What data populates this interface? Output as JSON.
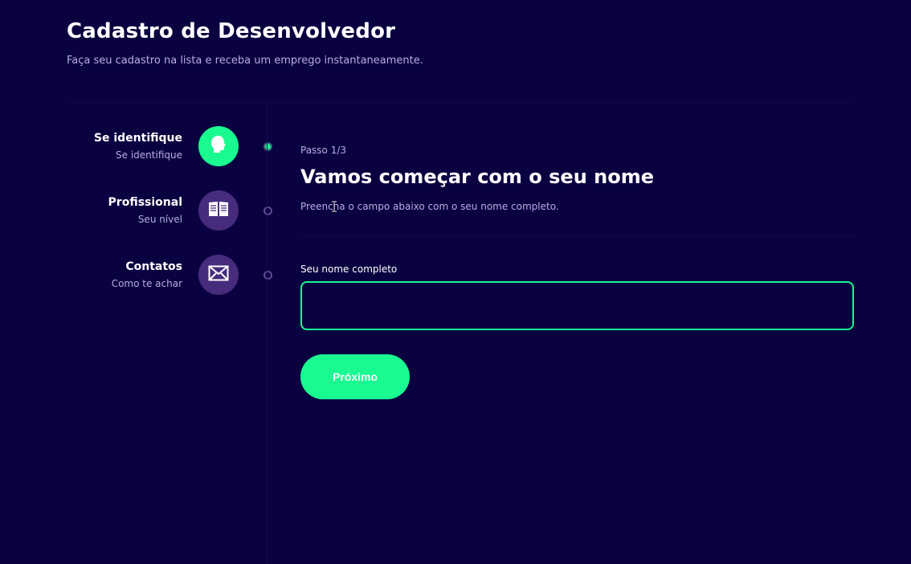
{
  "header": {
    "title": "Cadastro de Desenvolvedor",
    "subtitle": "Faça seu cadastro na lista e receba um emprego instantaneamente."
  },
  "steps": [
    {
      "title": "Se identifique",
      "subtitle": "Se identifique",
      "icon": "person-head-icon",
      "active": true
    },
    {
      "title": "Profissional",
      "subtitle": "Seu nível",
      "icon": "book-icon",
      "active": false
    },
    {
      "title": "Contatos",
      "subtitle": "Como te achar",
      "icon": "mail-icon",
      "active": false
    }
  ],
  "content": {
    "step_count": "Passo 1/3",
    "title": "Vamos começar com o seu nome",
    "lead": "Preencha o campo abaixo com o seu nome completo.",
    "field_label": "Seu nome completo",
    "field_value": "",
    "next_label": "Próximo"
  },
  "colors": {
    "background": "#0a0140",
    "accent": "#19fa91",
    "inactive_icon_bg": "#472c7e",
    "muted_text": "#b6aee0"
  }
}
